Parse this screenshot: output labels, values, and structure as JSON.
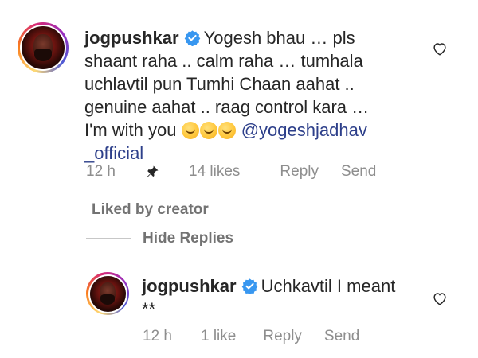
{
  "comment": {
    "username": "jogpushkar",
    "line1": "Yogesh bhau … pls",
    "line2": "shaant raha .. calm raha … tumhala",
    "line3": "uchlavtil pun Tumhi Chaan aahat ..",
    "line4": "genuine aahat .. raag control kara …",
    "line5_prefix": "I'm with you",
    "mention_part1": "@yogeshjadhav",
    "mention_part2": "_official",
    "time": "12 h",
    "likes": "14 likes",
    "reply": "Reply",
    "send": "Send",
    "icons": {
      "avatar": "avatar",
      "verified": "verified-badge-icon",
      "pin": "pin-icon",
      "heart": "heart-outline-icon",
      "emoji": "hugging-face-emoji"
    }
  },
  "liked_by_creator": "Liked by creator",
  "hide_replies": "Hide Replies",
  "reply_comment": {
    "username": "jogpushkar",
    "line1": "Uchkavtil I meant",
    "line2": "**",
    "time": "12 h",
    "likes": "1 like",
    "reply": "Reply",
    "send": "Send"
  },
  "colors": {
    "verified": "#3897f0",
    "mention": "#2d3f8a",
    "meta": "#8e8e8e",
    "text": "#262626"
  }
}
